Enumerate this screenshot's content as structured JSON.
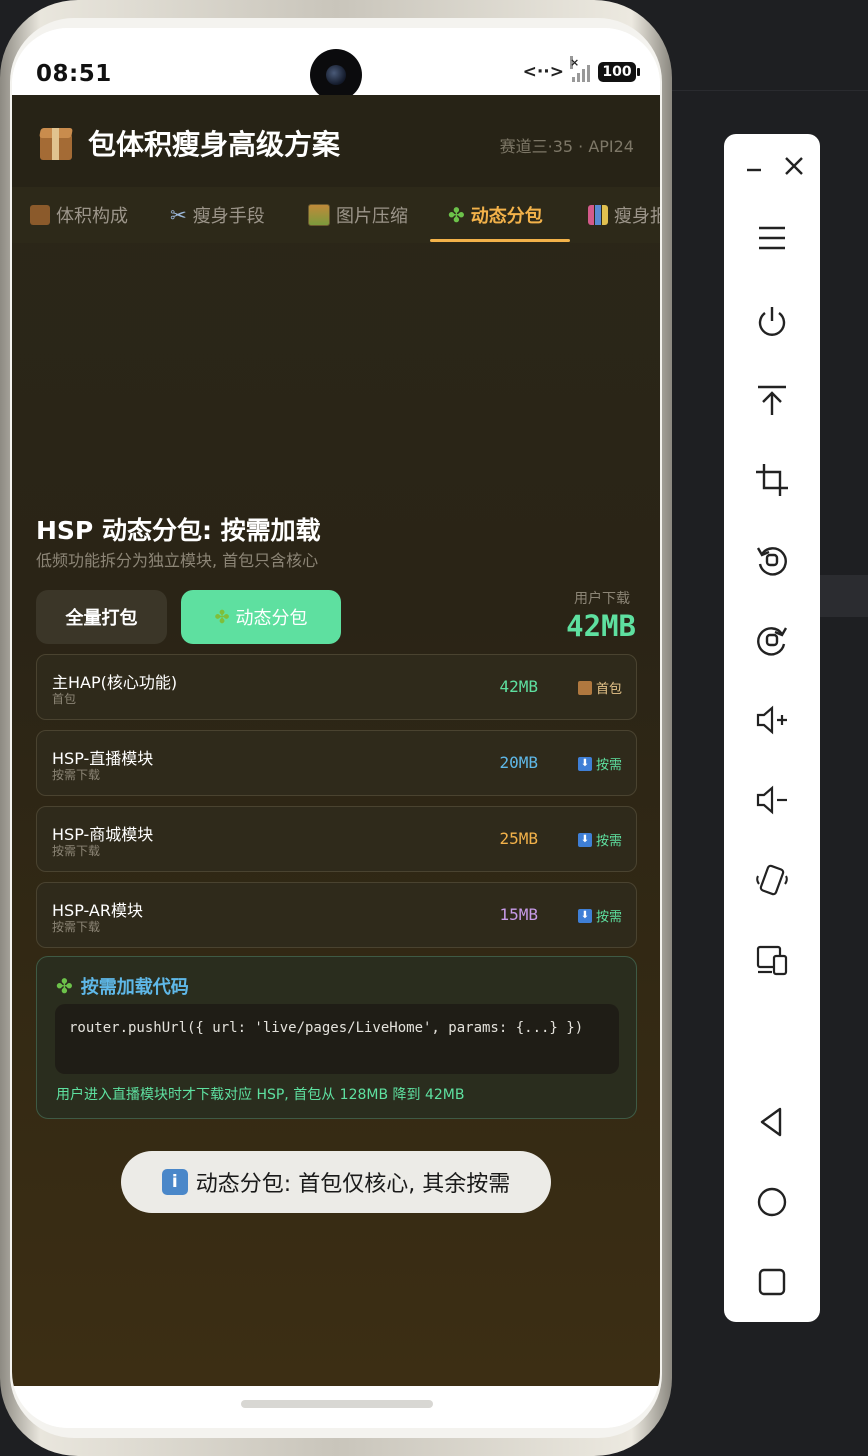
{
  "status_bar": {
    "time": "08:51",
    "data_indicator": "<··>",
    "signal_x": "×",
    "battery": "100"
  },
  "app": {
    "title": "包体积瘦身高级方案",
    "subtitle": "赛道三·35 · API24",
    "tabs": [
      {
        "label": "体积构成",
        "icon": "package-icon"
      },
      {
        "label": "瘦身手段",
        "icon": "scissors-icon"
      },
      {
        "label": "图片压缩",
        "icon": "picture-icon"
      },
      {
        "label": "动态分包",
        "icon": "puzzle-icon",
        "active": true
      },
      {
        "label": "瘦身报",
        "icon": "bar-chart-icon"
      }
    ]
  },
  "main": {
    "section_title": "HSP 动态分包: 按需加载",
    "section_desc": "低频功能拆分为独立模块, 首包只含核心",
    "buttons": {
      "full": "全量打包",
      "dynamic": "动态分包"
    },
    "download": {
      "label": "用户下载",
      "value": "42MB"
    },
    "modules": [
      {
        "name": "主HAP(核心功能)",
        "sub": "首包",
        "size": "42MB",
        "color": "#5ee0a0",
        "tag": "首包",
        "tag_icon": "package-icon",
        "tag_color": "#e6c48a"
      },
      {
        "name": "HSP-直播模块",
        "sub": "按需下载",
        "size": "20MB",
        "color": "#5fb8e8",
        "tag": "按需",
        "tag_icon": "download-icon",
        "tag_color": "#5ee0a0"
      },
      {
        "name": "HSP-商城模块",
        "sub": "按需下载",
        "size": "25MB",
        "color": "#f3b24a",
        "tag": "按需",
        "tag_icon": "download-icon",
        "tag_color": "#5ee0a0"
      },
      {
        "name": "HSP-AR模块",
        "sub": "按需下载",
        "size": "15MB",
        "color": "#c79be8",
        "tag": "按需",
        "tag_icon": "download-icon",
        "tag_color": "#5ee0a0"
      }
    ],
    "code_card": {
      "title": "按需加载代码",
      "code": "router.pushUrl({ url: 'live/pages/LiveHome', params: {...} })",
      "note": "用户进入直播模块时才下载对应 HSP, 首包从 128MB 降到 42MB"
    }
  },
  "toast": {
    "icon": "info-icon",
    "text": "动态分包: 首包仅核心, 其余按需"
  },
  "emulator_panel": {
    "buttons": [
      "minimize-icon",
      "close-icon",
      "menu-icon",
      "power-icon",
      "pin-top-icon",
      "crop-icon",
      "rotate-left-icon",
      "rotate-right-icon",
      "volume-up-icon",
      "volume-down-icon",
      "shake-icon",
      "multi-device-icon",
      "back-icon",
      "home-icon",
      "recents-icon"
    ]
  },
  "colors": {
    "accent_green": "#5ee0a0",
    "accent_orange": "#f3b24a",
    "accent_blue": "#5fb8e8",
    "accent_purple": "#c79be8"
  }
}
